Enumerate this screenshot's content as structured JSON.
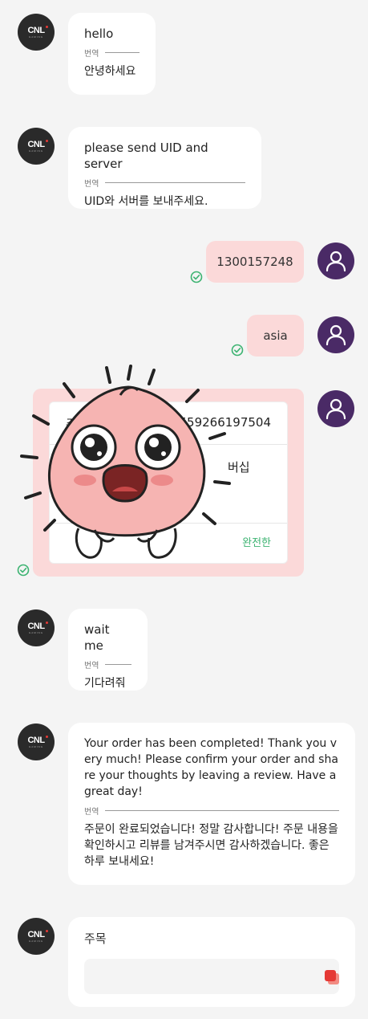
{
  "brand": {
    "logo_text": "CNL",
    "logo_sub": "GAMING"
  },
  "translation_label": "번역",
  "messages": [
    {
      "from": "agent",
      "text": "hello",
      "translation": "안녕하세요"
    },
    {
      "from": "agent",
      "text": "please send UID and server",
      "translation": "UID와 서버를 보내주세요."
    },
    {
      "from": "user",
      "text": "1300157248",
      "status": "read"
    },
    {
      "from": "user",
      "text": "asia",
      "status": "read"
    },
    {
      "from": "agent",
      "text": "wait me",
      "translation": "기다려줘"
    },
    {
      "from": "agent",
      "text": "Your order has been completed! Thank you very much! Please confirm your order and share your thoughts by leaving a review. Have a great day!",
      "translation": "주문이 완료되었습니다! 정말 감사합니다! 주문 내용을 확인하시고 리뷰를 남겨주시면 감사하겠습니다. 좋은 하루 보내세요!"
    }
  ],
  "order": {
    "label_prefix": "주문",
    "id_partial": "82559266197504",
    "product_partial": "버십",
    "status": "완전한"
  },
  "comment": {
    "title": "주목",
    "placeholder": ""
  },
  "colors": {
    "user_bubble": "#fbd9d9",
    "user_avatar": "#4a2a66",
    "brand_avatar": "#2a2a2a",
    "check": "#3cb371",
    "send": "#e53935"
  }
}
